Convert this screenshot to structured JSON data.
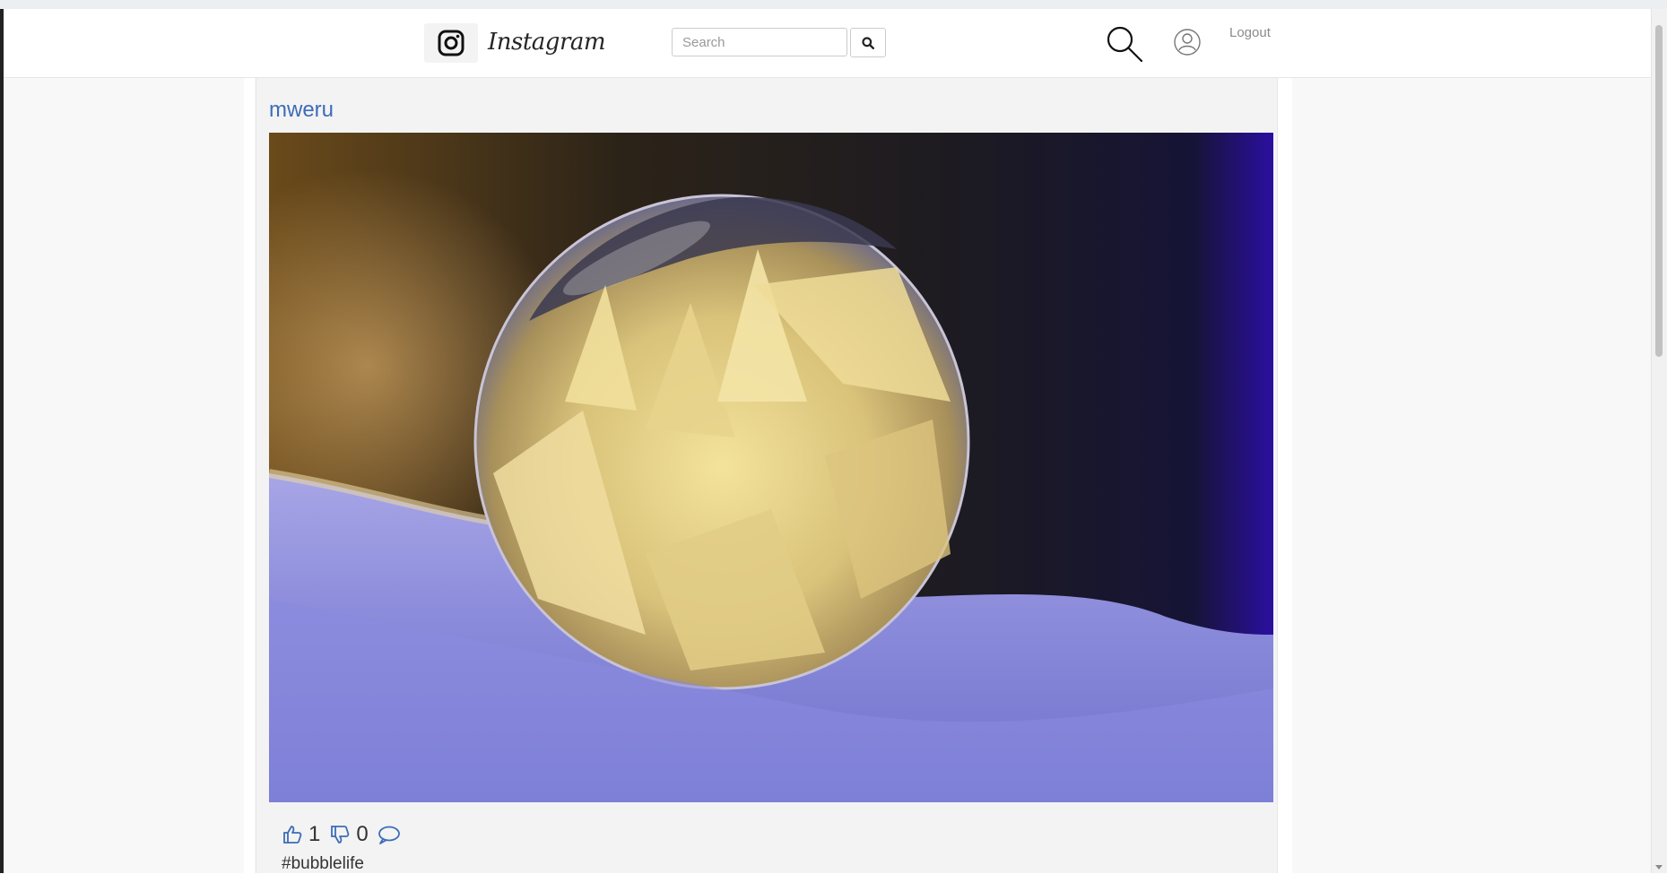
{
  "navbar": {
    "brand": "Instagram",
    "search": {
      "placeholder": "Search",
      "value": ""
    },
    "logout_label": "Logout",
    "icons": [
      "instagram-logo-icon",
      "search-icon",
      "magnifier-icon",
      "user-profile-icon"
    ]
  },
  "post": {
    "username": "mweru",
    "likes": "1",
    "dislikes": "0",
    "caption": "#bubblelife",
    "image_subject": "frozen soap bubble with frost feathers on snow",
    "icons": [
      "thumbs-up-icon",
      "thumbs-down-icon",
      "comment-icon"
    ]
  },
  "colors": {
    "link_blue": "#3d6cb9",
    "card_bg": "#f3f3f3",
    "page_bg": "#f8f8f8",
    "muted_text": "#8a8a8a"
  }
}
